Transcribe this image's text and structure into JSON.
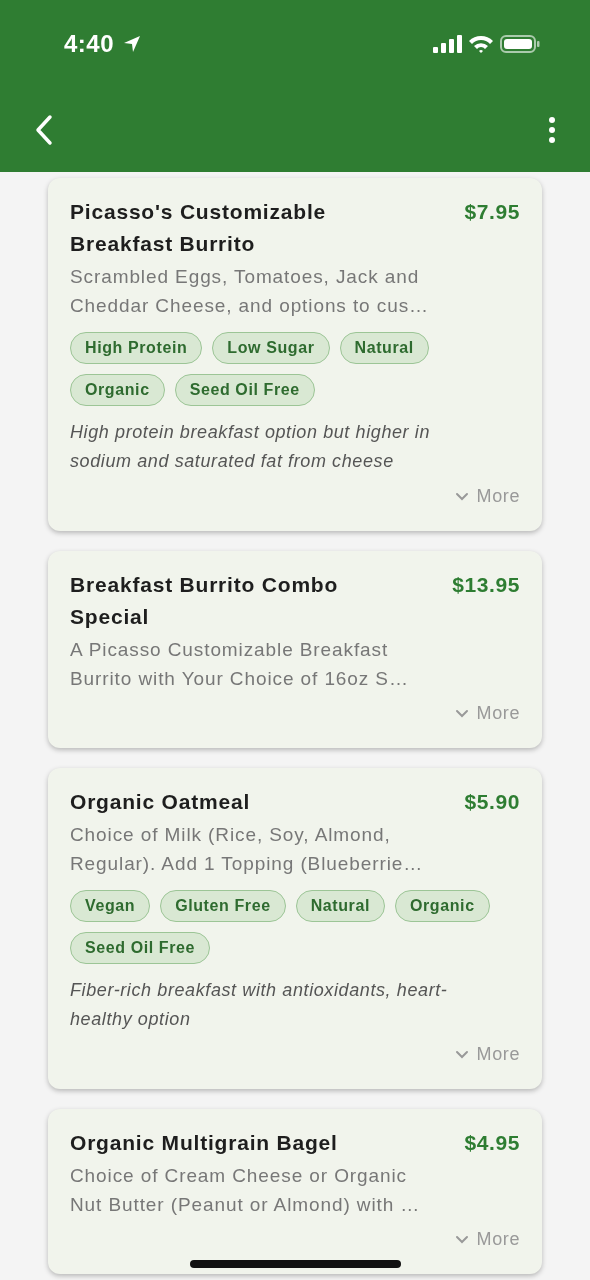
{
  "status_bar": {
    "time": "4:40"
  },
  "cards": [
    {
      "title": "Picasso's Customizable Breakfast Burrito",
      "price": "$7.95",
      "description_lines": [
        "Scrambled Eggs, Tomatoes, Jack and",
        "Cheddar Cheese, and options to cus…"
      ],
      "tags": [
        {
          "label": "High Protein"
        },
        {
          "label": "Low Sugar"
        },
        {
          "label": "Natural"
        },
        {
          "label": "Organic"
        },
        {
          "label": "Seed Oil Free"
        }
      ],
      "note_lines": [
        "High protein breakfast option but higher in",
        "sodium and saturated fat from cheese"
      ],
      "more": "More"
    },
    {
      "title": "Breakfast Burrito Combo Special",
      "price": "$13.95",
      "description_lines": [
        "A Picasso Customizable Breakfast",
        "Burrito with Your Choice of 16oz S…"
      ],
      "more": "More"
    },
    {
      "title": "Organic Oatmeal",
      "price": "$5.90",
      "description_lines": [
        "Choice of Milk (Rice, Soy, Almond,",
        "Regular). Add 1 Topping (Blueberrie…"
      ],
      "tags": [
        {
          "label": "Vegan"
        },
        {
          "label": "Gluten Free"
        },
        {
          "label": "Natural"
        },
        {
          "label": "Organic"
        },
        {
          "label": "Seed Oil Free"
        }
      ],
      "note_lines": [
        "Fiber-rich breakfast with antioxidants, heart-",
        "healthy option"
      ],
      "more": "More"
    },
    {
      "title": "Organic Multigrain Bagel",
      "price": "$4.95",
      "description_lines": [
        "Choice of Cream Cheese or Organic",
        "Nut Butter (Peanut or Almond) with …"
      ],
      "more": "More"
    }
  ]
}
